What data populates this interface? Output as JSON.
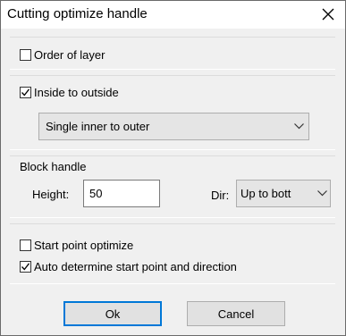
{
  "dialog": {
    "title": "Cutting optimize handle"
  },
  "order_of_layer": {
    "label": "Order of layer",
    "checked": false
  },
  "inside_to_outside": {
    "label": "Inside to outside",
    "checked": true,
    "mode_select": {
      "selected": "Single inner to outer"
    }
  },
  "block_handle": {
    "title": "Block handle",
    "height_label": "Height:",
    "height_value": "50",
    "dir_label": "Dir:",
    "dir_selected": "Up to bott"
  },
  "start_point": {
    "optimize_label": "Start point optimize",
    "optimize_checked": false,
    "auto_label": "Auto determine start point and direction",
    "auto_checked": true
  },
  "buttons": {
    "ok_label": "Ok",
    "cancel_label": "Cancel"
  },
  "icons": {
    "close": "close-icon",
    "dropdown": "chevron-down-icon",
    "check": "check-icon"
  },
  "colors": {
    "dialog_bg": "#f0f0f0",
    "title_bg": "#ffffff",
    "default_button_border": "#0078d7"
  }
}
